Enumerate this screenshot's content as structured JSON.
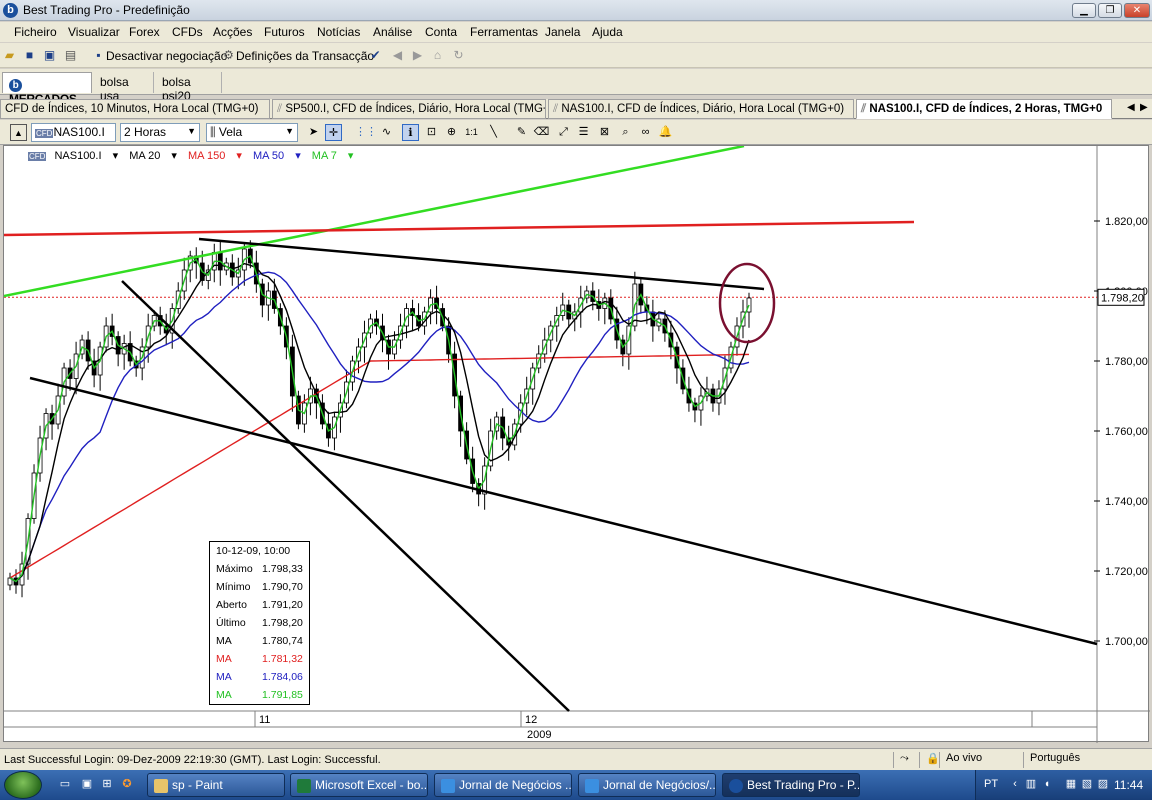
{
  "window": {
    "title": "Best Trading Pro - Predefinição",
    "app_letter": "b"
  },
  "menu": [
    "Ficheiro",
    "Visualizar",
    "Forex",
    "CFDs",
    "Acções",
    "Futuros",
    "Notícias",
    "Análise",
    "Conta",
    "Ferramentas",
    "Janela",
    "Ajuda"
  ],
  "toolbar": {
    "deactivate_label": "Desactivar negociação",
    "definitions_label": "Definições da Transacção"
  },
  "workspace_tabs": [
    "MERCADOS",
    "bolsa usa",
    "bolsa psi20"
  ],
  "chart_tabs": [
    "CFD de Índices, 10 Minutos, Hora Local (TMG+0)",
    "SP500.I, CFD de Índices, Diário, Hora Local (TMG+0)",
    "NAS100.I, CFD de Índices, Diário, Hora Local (TMG+0)",
    "NAS100.I, CFD de Índices, 2 Horas, TMG+0"
  ],
  "chart_toolbar": {
    "symbol": "NAS100.I",
    "timeframe": "2 Horas",
    "chart_type": "Vela"
  },
  "legend": {
    "symbol": "NAS100.I",
    "items": [
      {
        "label": "MA 20",
        "color": "#000000"
      },
      {
        "label": "MA 150",
        "color": "#e02020"
      },
      {
        "label": "MA 50",
        "color": "#2020c0"
      },
      {
        "label": "MA 7",
        "color": "#22c022"
      }
    ]
  },
  "info_box": {
    "date": "10-12-09, 10:00",
    "rows": [
      {
        "label": "Máximo",
        "value": "1.798,33",
        "color": "#000000"
      },
      {
        "label": "Mínimo",
        "value": "1.790,70",
        "color": "#000000"
      },
      {
        "label": "Aberto",
        "value": "1.791,20",
        "color": "#000000"
      },
      {
        "label": "Último",
        "value": "1.798,20",
        "color": "#000000"
      },
      {
        "label": "MA",
        "value": "1.780,74",
        "color": "#000000"
      },
      {
        "label": "MA",
        "value": "1.781,32",
        "color": "#e02020"
      },
      {
        "label": "MA",
        "value": "1.784,06",
        "color": "#2020c0"
      },
      {
        "label": "MA",
        "value": "1.791,85",
        "color": "#22c022"
      }
    ]
  },
  "axes": {
    "y_ticks": [
      "1.820,00",
      "1.800,00",
      "1.780,00",
      "1.760,00",
      "1.740,00",
      "1.720,00",
      "1.700,00"
    ],
    "y_tick_values": [
      1820,
      1800,
      1780,
      1760,
      1740,
      1720,
      1700
    ],
    "current_price_label": "1.798,20",
    "current_price": 1798.2,
    "x_labels": [
      "11",
      "12"
    ],
    "year_label": "2009"
  },
  "status": {
    "login_text": "Last Successful Login: 09-Dez-2009 22:19:30 (GMT). Last Login: Successful.",
    "mode": "Ao vivo",
    "language": "Português"
  },
  "taskbar": {
    "buttons": [
      "sp - Paint",
      "Microsoft Excel - bo...",
      "Jornal de Negócios ...",
      "Jornal de Negócios/...",
      "Best Trading Pro - P..."
    ],
    "lang": "PT",
    "clock": "11:44"
  }
}
